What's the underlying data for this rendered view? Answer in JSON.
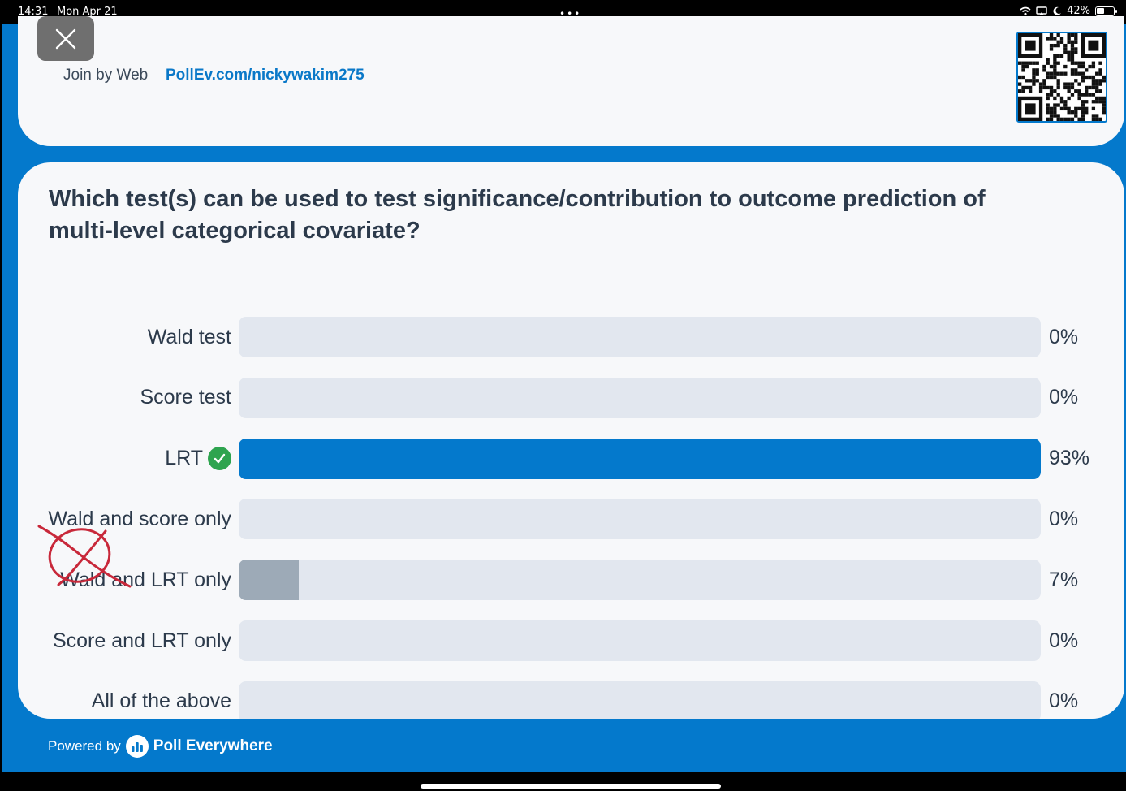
{
  "status_bar": {
    "time": "14:31",
    "date": "Mon Apr 21",
    "dots": "•••",
    "battery": "42%"
  },
  "header": {
    "join_label": "Join by Web",
    "join_url": "PollEv.com/nickywakim275"
  },
  "poll": {
    "question": "Which test(s) can be used to test significance/contribution to outcome prediction of multi-level categorical covariate?",
    "options": [
      {
        "label": "Wald test",
        "percent": 0,
        "percent_label": "0%",
        "correct": false,
        "color": "#e2e7ef"
      },
      {
        "label": "Score test",
        "percent": 0,
        "percent_label": "0%",
        "correct": false,
        "color": "#e2e7ef"
      },
      {
        "label": "LRT",
        "percent": 93,
        "percent_label": "93%",
        "correct": true,
        "color": "#0479cc"
      },
      {
        "label": "Wald and score only",
        "percent": 0,
        "percent_label": "0%",
        "correct": false,
        "color": "#e2e7ef"
      },
      {
        "label": "Wald and LRT only",
        "percent": 7,
        "percent_label": "7%",
        "correct": false,
        "color": "#9daab7"
      },
      {
        "label": "Score and LRT only",
        "percent": 0,
        "percent_label": "0%",
        "correct": false,
        "color": "#e2e7ef"
      },
      {
        "label": "All of the above",
        "percent": 0,
        "percent_label": "0%",
        "correct": false,
        "color": "#e2e7ef"
      }
    ]
  },
  "footer": {
    "powered_by": "Powered by",
    "brand": "Poll Everywhere"
  },
  "colors": {
    "accent": "#0479cc",
    "correct": "#2ea44f",
    "annotation": "#c8283a"
  }
}
